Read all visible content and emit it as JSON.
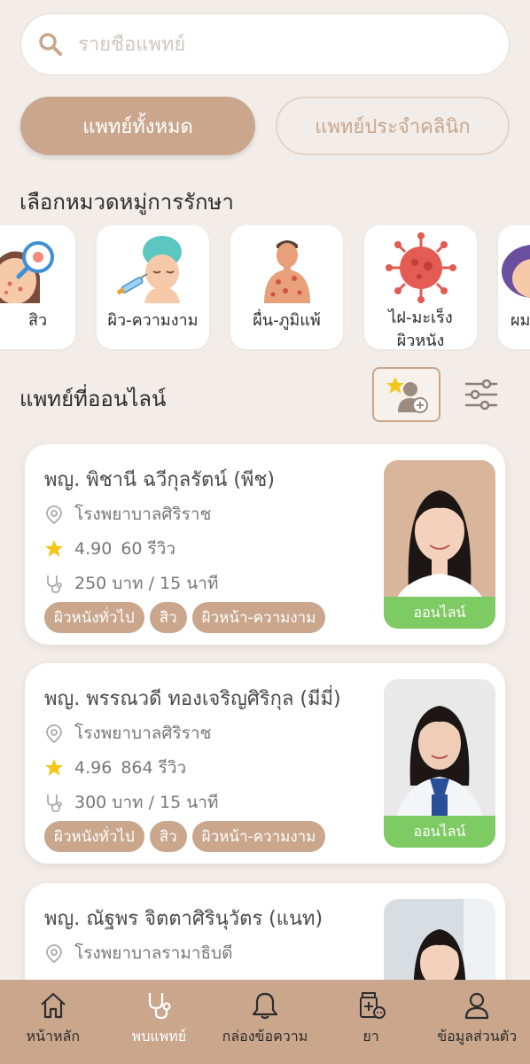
{
  "search": {
    "placeholder": "รายชื่อแพทย์"
  },
  "segments": {
    "all": "แพทย์ทั้งหมด",
    "clinic": "แพทย์ประจำคลินิก"
  },
  "categories_title": "เลือกหมวดหมู่การรักษา",
  "categories": [
    {
      "label": "สิว",
      "icon": "acne-face-icon"
    },
    {
      "label": "ผิว-ความงาม",
      "icon": "beauty-injection-icon"
    },
    {
      "label": "ผื่น-ภูมิแพ้",
      "icon": "rash-allergy-icon"
    },
    {
      "label": "ไฝ-มะเร็ง ผิวหนัง",
      "icon": "mole-cancer-icon"
    },
    {
      "label": "ผม",
      "icon": "hair-icon"
    }
  ],
  "online_title": "แพทย์ที่ออนไลน์",
  "doctors": [
    {
      "name": "พญ. พิชานี ฉวีกุลรัตน์ (พีช)",
      "hospital": "โรงพยาบาลศิริราช",
      "rating": "4.90",
      "reviews": "60 รีวิว",
      "price": "250 บาท / 15 นาที",
      "tags": [
        "ผิวหนังทั่วไป",
        "สิว",
        "ผิวหน้า-ความงาม"
      ],
      "status": "ออนไลน์"
    },
    {
      "name": "พญ. พรรณวดี ทองเจริญศิริกุล (มีมี่)",
      "hospital": "โรงพยาบาลศิริราช",
      "rating": "4.96",
      "reviews": "864 รีวิว",
      "price": "300 บาท / 15 นาที",
      "tags": [
        "ผิวหนังทั่วไป",
        "สิว",
        "ผิวหน้า-ความงาม"
      ],
      "status": "ออนไลน์"
    },
    {
      "name": "พญ. ณัฐพร จิตตาศิรินุวัตร (แนท)",
      "hospital": "โรงพยาบาลรามาธิบดี"
    }
  ],
  "nav": [
    {
      "label": "หน้าหลัก",
      "icon": "home-icon"
    },
    {
      "label": "พบแพทย์",
      "icon": "stethoscope-icon"
    },
    {
      "label": "กล่องข้อความ",
      "icon": "bell-icon"
    },
    {
      "label": "ยา",
      "icon": "medicine-icon"
    },
    {
      "label": "ข้อมูลส่วนตัว",
      "icon": "profile-icon"
    }
  ],
  "colors": {
    "accent": "#c9a68c",
    "online": "#7ecb63",
    "background": "#f2ede9"
  }
}
